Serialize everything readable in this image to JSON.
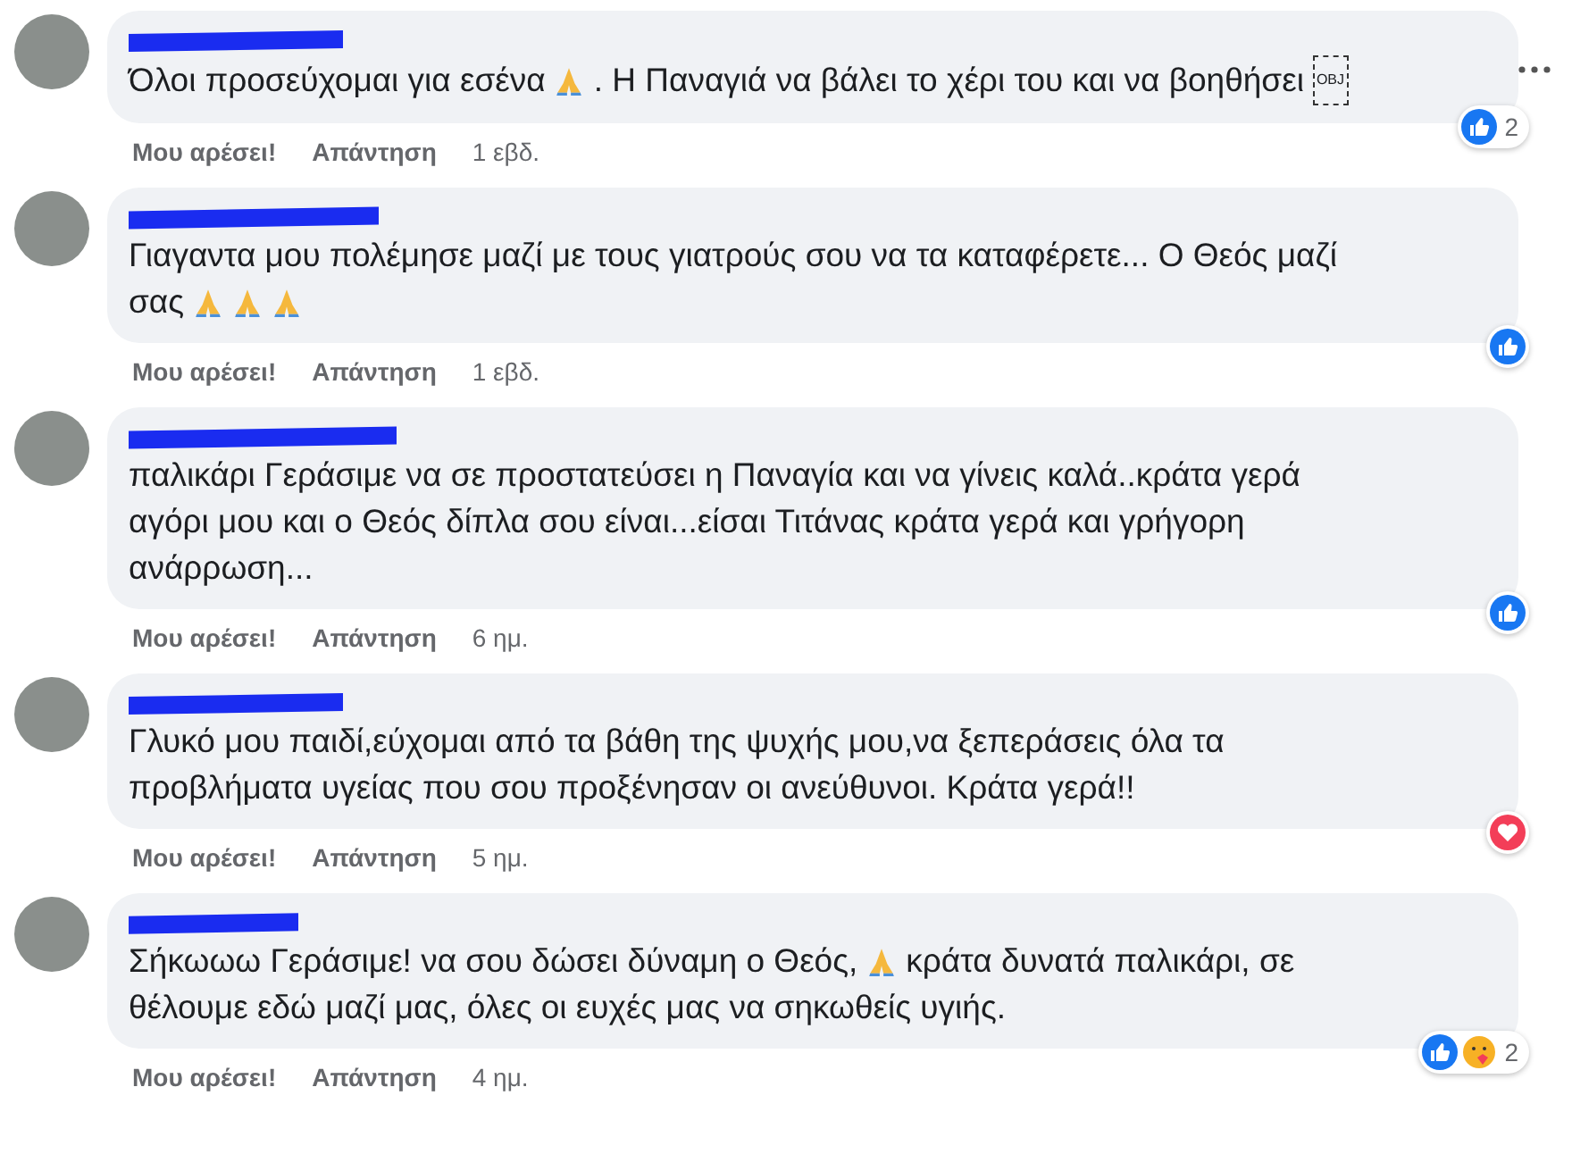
{
  "more_menu": true,
  "comments": [
    {
      "lines": [
        [
          {
            "kind": "text",
            "text": "Όλοι προσεύχομαι για εσένα"
          },
          {
            "kind": "pray"
          },
          {
            "kind": "text",
            "text": ". Η Παναγιά να βάλει το χέρι του και να βοηθήσει"
          },
          {
            "kind": "obj",
            "text": "OBJ"
          }
        ]
      ],
      "actions": [
        "Μου αρέσει!",
        "Απάντηση"
      ],
      "time": "1 εβδ.",
      "reactions": [
        {
          "kind": "like"
        }
      ],
      "count": "2"
    },
    {
      "lines": [
        [
          {
            "kind": "text",
            "text": "Γιαγαντα μου πολέμησε μαζί με τους γιατρούς σου να τα καταφέρετε... Ο Θεός μαζί"
          }
        ],
        [
          {
            "kind": "text",
            "text": "σας"
          },
          {
            "kind": "pray"
          },
          {
            "kind": "pray"
          },
          {
            "kind": "pray"
          }
        ]
      ],
      "actions": [
        "Μου αρέσει!",
        "Απάντηση"
      ],
      "time": "1 εβδ.",
      "reactions": [
        {
          "kind": "like"
        }
      ]
    },
    {
      "lines": [
        [
          {
            "kind": "text",
            "text": "παλικάρι Γεράσιμε να σε προστατεύσει η Παναγία και να γίνεις καλά..κράτα γερά"
          }
        ],
        [
          {
            "kind": "text",
            "text": "αγόρι μου και ο Θεός δίπλα σου είναι...είσαι Τιτάνας κράτα γερά και γρήγορη"
          }
        ],
        [
          {
            "kind": "text",
            "text": "ανάρρωση..."
          }
        ]
      ],
      "actions": [
        "Μου αρέσει!",
        "Απάντηση"
      ],
      "time": "6 ημ.",
      "reactions": [
        {
          "kind": "like"
        }
      ]
    },
    {
      "lines": [
        [
          {
            "kind": "text",
            "text": "Γλυκό μου παιδί,εύχομαι από τα βάθη της ψυχής μου,να ξεπεράσεις όλα τα"
          }
        ],
        [
          {
            "kind": "text",
            "text": "προβλήματα υγείας που σου προξένησαν οι ανεύθυνοι. Κράτα γερά!!"
          }
        ]
      ],
      "actions": [
        "Μου αρέσει!",
        "Απάντηση"
      ],
      "time": "5 ημ.",
      "reactions": [
        {
          "kind": "love"
        }
      ]
    },
    {
      "lines": [
        [
          {
            "kind": "text",
            "text": "Σήκωωω Γεράσιμε! να σου δώσει δύναμη ο Θεός,"
          },
          {
            "kind": "pray"
          },
          {
            "kind": "text",
            "text": "κράτα δυνατά παλικάρι, σε"
          }
        ],
        [
          {
            "kind": "text",
            "text": "θέλουμε εδώ μαζί μας, όλες οι ευχές μας να σηκωθείς υγιής."
          }
        ]
      ],
      "actions": [
        "Μου αρέσει!",
        "Απάντηση"
      ],
      "time": "4 ημ.",
      "reactions": [
        {
          "kind": "like"
        },
        {
          "kind": "care"
        }
      ],
      "count": "2"
    }
  ]
}
